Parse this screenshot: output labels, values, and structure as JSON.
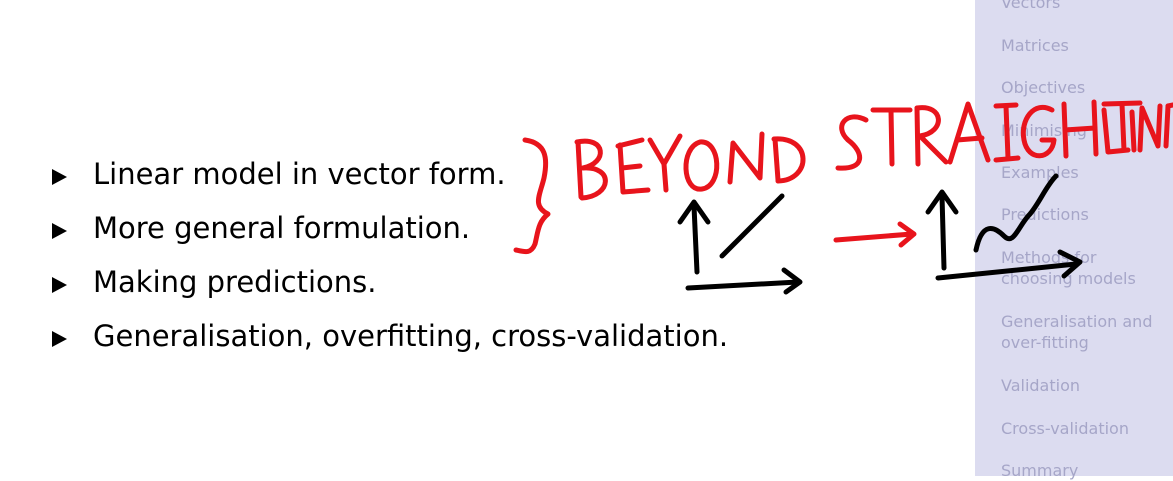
{
  "bullets": [
    "Linear model in vector form.",
    "More general formulation.",
    "Making predictions.",
    "Generalisation, overfitting, cross-validation."
  ],
  "annotation": "BEYOND STRAIGHT LINE",
  "sidebar": {
    "items": [
      "Vectors",
      "Matrices",
      "Objectives",
      "Minimising",
      "Examples",
      "Predictions",
      "Methods for choosing models",
      "Generalisation and over-fitting",
      "Validation",
      "Cross-validation",
      "Summary"
    ]
  },
  "colors": {
    "sidebar_bg": "#dcdcf0",
    "sidebar_text": "#a6a6c8",
    "ink_red": "#e8141c",
    "ink_black": "#000000"
  }
}
